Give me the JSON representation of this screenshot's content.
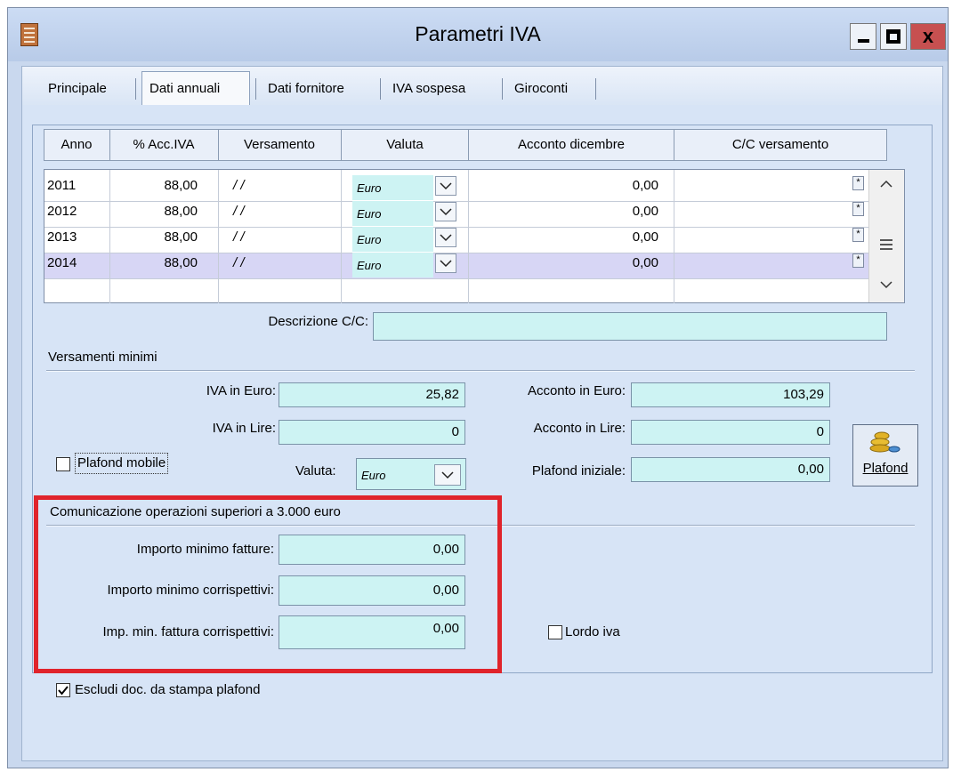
{
  "window": {
    "title": "Parametri IVA",
    "close_glyph": "x"
  },
  "tabs": [
    "Principale",
    "Dati annuali",
    "Dati fornitore",
    "IVA sospesa",
    "Giroconti"
  ],
  "grid": {
    "headers": [
      "Anno",
      "% Acc.IVA",
      "Versamento",
      "Valuta",
      "Acconto dicembre",
      "C/C versamento"
    ],
    "rows": [
      {
        "anno": "2011",
        "acc": "88,00",
        "versamento": "/ /",
        "valuta": "Euro",
        "acconto": "0,00",
        "cc": "",
        "selected": false
      },
      {
        "anno": "2012",
        "acc": "88,00",
        "versamento": "/ /",
        "valuta": "Euro",
        "acconto": "0,00",
        "cc": "",
        "selected": false
      },
      {
        "anno": "2013",
        "acc": "88,00",
        "versamento": "/ /",
        "valuta": "Euro",
        "acconto": "0,00",
        "cc": "",
        "selected": false
      },
      {
        "anno": "2014",
        "acc": "88,00",
        "versamento": "/ /",
        "valuta": "Euro",
        "acconto": "0,00",
        "cc": "",
        "selected": true
      }
    ],
    "ellipsis_glyph": "*"
  },
  "descrizione_cc": {
    "label": "Descrizione C/C:",
    "value": ""
  },
  "versamenti": {
    "section_title": "Versamenti minimi",
    "iva_euro_label": "IVA in Euro:",
    "iva_euro": "25,82",
    "iva_lire_label": "IVA in Lire:",
    "iva_lire": "0",
    "acconto_euro_label": "Acconto in Euro:",
    "acconto_euro": "103,29",
    "acconto_lire_label": "Acconto in Lire:",
    "acconto_lire": "0",
    "plafond_iniziale_label": "Plafond iniziale:",
    "plafond_iniziale": "0,00",
    "plafond_mobile_label": "Plafond mobile",
    "plafond_mobile_checked": false,
    "valuta_label": "Valuta:",
    "valuta_value": "Euro",
    "plafond_button": "Plafond"
  },
  "comunicazione": {
    "section_title": "Comunicazione operazioni superiori a 3.000 euro",
    "importo_fatture_label": "Importo minimo fatture:",
    "importo_fatture": "0,00",
    "importo_corrispettivi_label": "Importo minimo corrispettivi:",
    "importo_corrispettivi": "0,00",
    "imp_fattura_corrispettivi_label": "Imp. min. fattura corrispettivi:",
    "imp_fattura_corrispettivi": "0,00"
  },
  "lordo_iva": {
    "label": "Lordo iva",
    "checked": false
  },
  "escludi": {
    "label": "Escludi doc. da stampa plafond",
    "checked": true
  },
  "colors": {
    "highlight": "#e0232b",
    "field_bg": "#cdf3f3",
    "selected_row": "#d7d6f5"
  }
}
